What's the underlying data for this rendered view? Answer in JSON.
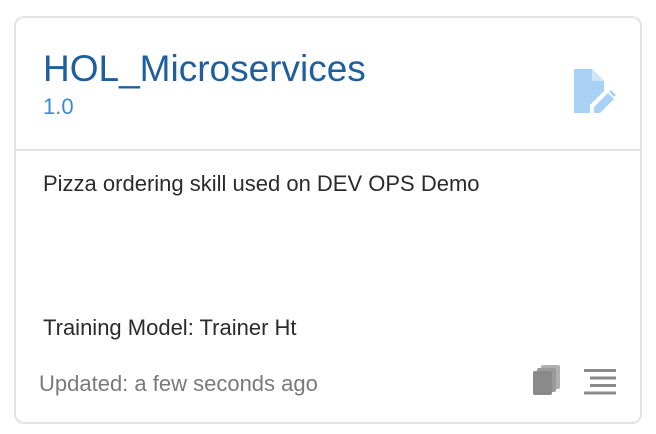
{
  "card": {
    "title": "HOL_Microservices",
    "version": "1.0",
    "description": "Pizza ordering skill used on DEV OPS Demo",
    "training_model": "Training Model: Trainer Ht",
    "updated": "Updated: a few seconds ago"
  },
  "icons": {
    "edit": "edit-document-icon",
    "copy": "copy-icon",
    "menu": "menu-lines-icon"
  },
  "colors": {
    "title": "#1f5f9f",
    "version": "#3a8ad6",
    "edit_icon": "#a9d1f4",
    "footer_icons": "#8a8a8a",
    "border": "#e3e3e3"
  }
}
